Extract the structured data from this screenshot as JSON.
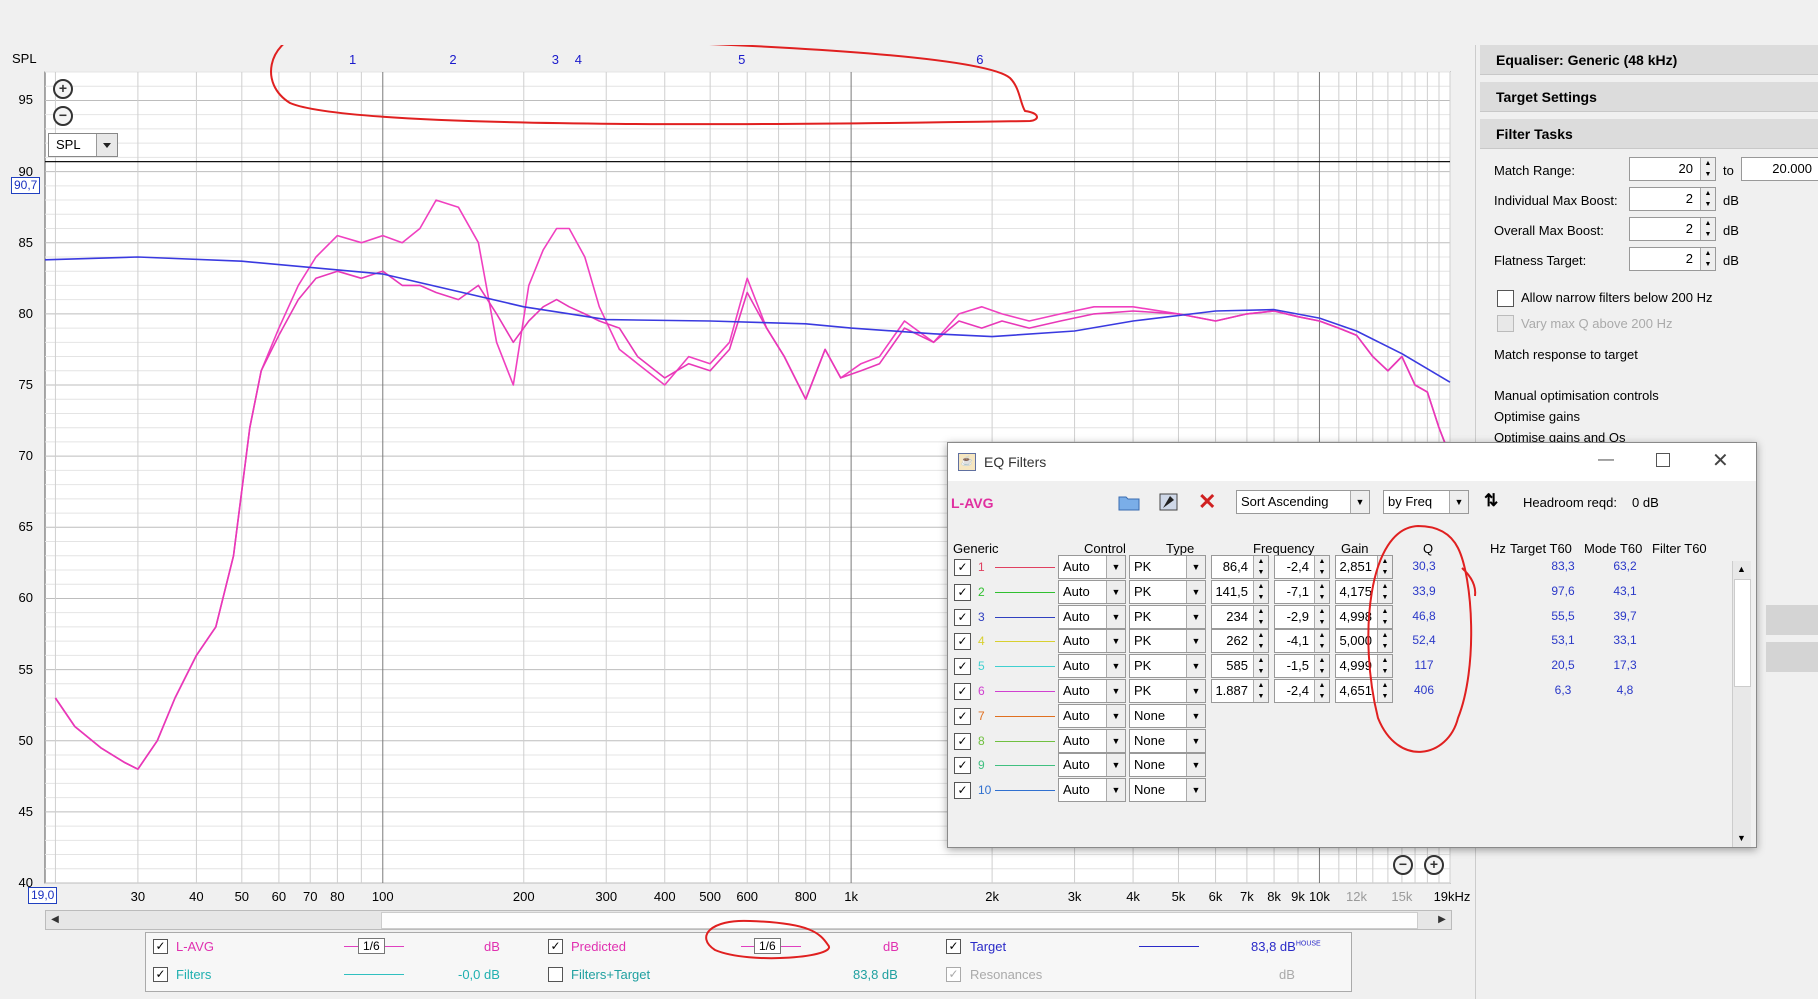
{
  "graph": {
    "y_axis_label": "SPL",
    "cursor_value": "90,7",
    "x_start_value": "19,0",
    "view_select": "SPL",
    "y_ticks": [
      "95",
      "90",
      "85",
      "80",
      "75",
      "70",
      "65",
      "60",
      "55",
      "50",
      "45",
      "40"
    ],
    "x_ticks": [
      {
        "label": "30",
        "f": 30
      },
      {
        "label": "40",
        "f": 40
      },
      {
        "label": "50",
        "f": 50
      },
      {
        "label": "60",
        "f": 60
      },
      {
        "label": "70",
        "f": 70
      },
      {
        "label": "80",
        "f": 80
      },
      {
        "label": "100",
        "f": 100
      },
      {
        "label": "200",
        "f": 200
      },
      {
        "label": "300",
        "f": 300
      },
      {
        "label": "400",
        "f": 400
      },
      {
        "label": "500",
        "f": 500
      },
      {
        "label": "600",
        "f": 600
      },
      {
        "label": "800",
        "f": 800
      },
      {
        "label": "1k",
        "f": 1000
      },
      {
        "label": "2k",
        "f": 2000
      },
      {
        "label": "3k",
        "f": 3000
      },
      {
        "label": "4k",
        "f": 4000
      },
      {
        "label": "5k",
        "f": 5000
      },
      {
        "label": "6k",
        "f": 6000
      },
      {
        "label": "7k",
        "f": 7000
      },
      {
        "label": "8k",
        "f": 8000
      },
      {
        "label": "9k",
        "f": 9000
      },
      {
        "label": "10k",
        "f": 10000
      },
      {
        "label": "12k",
        "f": 12000,
        "grey": true
      },
      {
        "label": "15k",
        "f": 15000,
        "grey": true
      },
      {
        "label": "19kHz",
        "f": 19000
      }
    ],
    "filter_markers": [
      {
        "label": "1",
        "f": 86.4
      },
      {
        "label": "2",
        "f": 141.5
      },
      {
        "label": "3",
        "f": 234
      },
      {
        "label": "4",
        "f": 262
      },
      {
        "label": "5",
        "f": 585
      },
      {
        "label": "6",
        "f": 1887
      }
    ],
    "colors": {
      "measurement": "#f040c0",
      "predicted": "#e830b8",
      "target": "#3a3ae0",
      "annotation": "#e02020",
      "axis_label": "#1a1acc"
    }
  },
  "chart_data": {
    "type": "line",
    "xlabel": "",
    "ylabel": "SPL",
    "x_scale": "log",
    "xlim": [
      19,
      19000
    ],
    "ylim": [
      40,
      97
    ],
    "series": [
      {
        "name": "L-AVG",
        "x": [
          20,
          22,
          25,
          28,
          30,
          33,
          36,
          40,
          44,
          48,
          52,
          55,
          60,
          66,
          72,
          80,
          90,
          100,
          110,
          120,
          130,
          145,
          160,
          175,
          190,
          205,
          220,
          235,
          250,
          270,
          290,
          320,
          350,
          400,
          450,
          500,
          550,
          600,
          660,
          720,
          800,
          880,
          950,
          1050,
          1150,
          1300,
          1500,
          1700,
          1900,
          2100,
          2400,
          2800,
          3300,
          4000,
          5000,
          6000,
          7000,
          8000,
          9000,
          10000,
          11000,
          12000,
          13000,
          14000,
          15000,
          16000,
          17000,
          18000,
          19000
        ],
        "y": [
          53,
          51,
          49.5,
          48.5,
          48,
          50,
          53,
          56,
          58,
          63,
          72,
          76,
          79,
          82,
          84,
          85.5,
          85,
          85.5,
          85,
          86,
          88,
          87.5,
          85,
          78,
          75,
          82,
          84.5,
          86,
          86,
          84,
          80.5,
          77.5,
          76.5,
          75,
          77,
          76.5,
          78,
          82.5,
          79,
          77,
          74,
          77.5,
          75.5,
          76.5,
          77,
          79.5,
          78,
          80,
          80.5,
          80,
          79.5,
          80,
          80.5,
          80.5,
          80,
          79.5,
          80,
          80.2,
          79.8,
          79.5,
          79,
          78.5,
          77,
          76,
          77,
          75,
          74.5,
          72,
          70
        ]
      },
      {
        "name": "Predicted",
        "x": [
          20,
          22,
          25,
          28,
          30,
          33,
          36,
          40,
          44,
          48,
          52,
          55,
          60,
          66,
          72,
          80,
          90,
          100,
          110,
          120,
          130,
          145,
          160,
          175,
          190,
          205,
          220,
          235,
          250,
          270,
          290,
          320,
          350,
          400,
          450,
          500,
          550,
          600,
          660,
          720,
          800,
          880,
          950,
          1050,
          1150,
          1300,
          1500,
          1700,
          1900,
          2100,
          2400,
          2800,
          3300,
          4000,
          5000,
          6000,
          7000,
          8000,
          9000,
          10000,
          11000,
          12000,
          13000,
          14000,
          15000,
          16000,
          17000,
          18000,
          19000
        ],
        "y": [
          53,
          51,
          49.5,
          48.5,
          48,
          50,
          53,
          56,
          58,
          63,
          72,
          76,
          78.5,
          81,
          82.5,
          83,
          82.5,
          83,
          82,
          82,
          81.5,
          81,
          82,
          80,
          78,
          79.5,
          80.5,
          81,
          80.5,
          80,
          79.5,
          79,
          77,
          75.5,
          76.5,
          76,
          77.5,
          81.5,
          79,
          77,
          74,
          77.5,
          75.5,
          76,
          76.5,
          79,
          78,
          79.5,
          79,
          79.5,
          79,
          79.5,
          80,
          80.2,
          80,
          79.5,
          80,
          80.2,
          79.8,
          79.5,
          79,
          78.5,
          77,
          76,
          77,
          75,
          74.5,
          72,
          70
        ]
      },
      {
        "name": "Target",
        "x": [
          19,
          30,
          50,
          100,
          200,
          300,
          500,
          800,
          1000,
          1500,
          2000,
          3000,
          4000,
          6000,
          8000,
          10000,
          12000,
          15000,
          19000
        ],
        "y": [
          83.8,
          84,
          83.7,
          82.8,
          80.5,
          79.6,
          79.5,
          79.3,
          79,
          78.6,
          78.4,
          78.8,
          79.5,
          80.2,
          80.3,
          79.7,
          78.8,
          77.2,
          75.2
        ]
      }
    ],
    "horizontal_line": 90.7
  },
  "legend": {
    "lavg": {
      "label": "L-AVG",
      "smoothing": "1/6",
      "value": "dB"
    },
    "predicted": {
      "label": "Predicted",
      "smoothing": "1/6",
      "value": "dB"
    },
    "target": {
      "label": "Target",
      "value": "83,8 dB",
      "superscript": "HOUSE"
    },
    "filters": {
      "label": "Filters",
      "value": "-0,0 dB"
    },
    "filters_target": {
      "label": "Filters+Target",
      "value": "83,8 dB"
    },
    "resonances": {
      "label": "Resonances",
      "value": "dB"
    }
  },
  "rpanel": {
    "sections": [
      "Equaliser: Generic (48 kHz)",
      "Target Settings",
      "Filter Tasks"
    ],
    "match_range_label": "Match Range:",
    "match_range_from": "20",
    "match_range_to_label": "to",
    "match_range_to": "20.000",
    "ind_max_boost_label": "Individual Max Boost:",
    "ind_max_boost": "2",
    "overall_max_boost_label": "Overall Max Boost:",
    "overall_max_boost": "2",
    "flatness_label": "Flatness Target:",
    "flatness": "2",
    "db": "dB",
    "allow_narrow": "Allow narrow filters below 200 Hz",
    "vary_q": "Vary max Q above 200 Hz",
    "match_response": "Match response to target",
    "manual_opt": "Manual optimisation controls",
    "opt_gains": "Optimise gains",
    "opt_gains_qs": "Optimise gains and Qs"
  },
  "dialog": {
    "title": "EQ Filters",
    "measurement": "L-AVG",
    "sort": "Sort Ascending",
    "by": "by Freq",
    "headroom_label": "Headroom reqd:",
    "headroom": "0 dB",
    "headers": {
      "generic": "Generic",
      "control": "Control",
      "type": "Type",
      "freq": "Frequency",
      "gain": "Gain",
      "q": "Q",
      "hz": "Hz",
      "target_t60": "Target T60",
      "mode_t60": "Mode T60",
      "filter_t60": "Filter T60"
    },
    "rows": [
      {
        "n": "1",
        "color": "#e04060",
        "control": "Auto",
        "type": "PK",
        "freq": "86,4",
        "gain": "-2,4",
        "q": "2,851",
        "hz": "30,3",
        "target": "83,3",
        "filter": "63,2"
      },
      {
        "n": "2",
        "color": "#30c030",
        "control": "Auto",
        "type": "PK",
        "freq": "141,5",
        "gain": "-7,1",
        "q": "4,175",
        "hz": "33,9",
        "target": "97,6",
        "filter": "43,1"
      },
      {
        "n": "3",
        "color": "#3040c0",
        "control": "Auto",
        "type": "PK",
        "freq": "234",
        "gain": "-2,9",
        "q": "4,998",
        "hz": "46,8",
        "target": "55,5",
        "filter": "39,7"
      },
      {
        "n": "4",
        "color": "#d8d030",
        "control": "Auto",
        "type": "PK",
        "freq": "262",
        "gain": "-4,1",
        "q": "5,000",
        "hz": "52,4",
        "target": "53,1",
        "filter": "33,1"
      },
      {
        "n": "5",
        "color": "#40d0d0",
        "control": "Auto",
        "type": "PK",
        "freq": "585",
        "gain": "-1,5",
        "q": "4,999",
        "hz": "117",
        "target": "20,5",
        "filter": "17,3"
      },
      {
        "n": "6",
        "color": "#d040d0",
        "control": "Auto",
        "type": "PK",
        "freq": "1.887",
        "gain": "-2,4",
        "q": "4,651",
        "hz": "406",
        "target": "6,3",
        "filter": "4,8"
      },
      {
        "n": "7",
        "color": "#e07020",
        "control": "Auto",
        "type": "None"
      },
      {
        "n": "8",
        "color": "#70c040",
        "control": "Auto",
        "type": "None"
      },
      {
        "n": "9",
        "color": "#40c080",
        "control": "Auto",
        "type": "None"
      },
      {
        "n": "10",
        "color": "#3070d0",
        "control": "Auto",
        "type": "None"
      }
    ]
  }
}
